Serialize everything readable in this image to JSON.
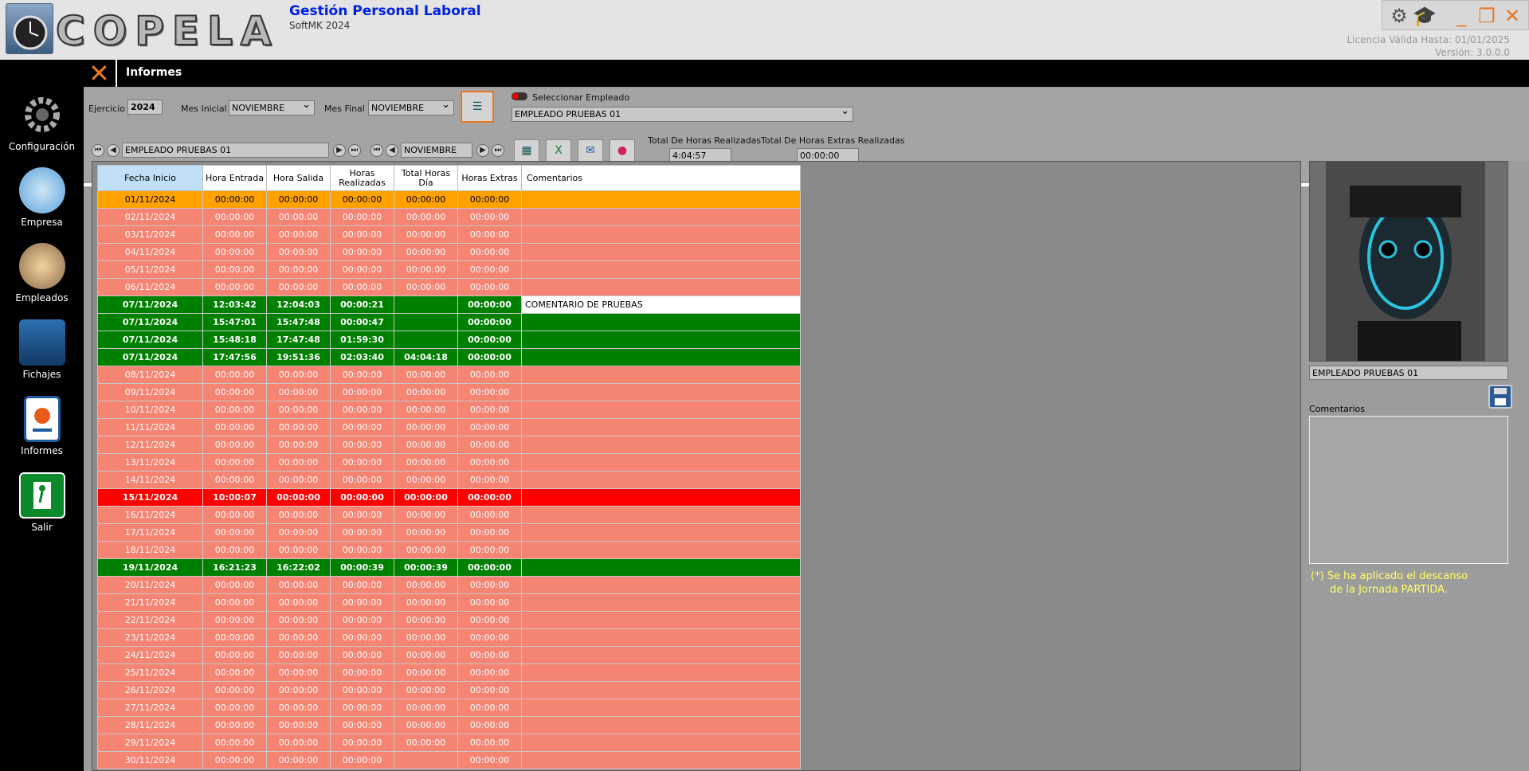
{
  "app": {
    "title": "Gestión Personal Laboral",
    "subtitle": "SoftMK 2024",
    "logo_text": "COPELA",
    "license": "Licencia Válida Hasta: 01/01/2025",
    "version": "Versión: 3.0.0.0"
  },
  "sidebar": {
    "items": [
      {
        "label": "Configuración",
        "icon": "gears-icon"
      },
      {
        "label": "Empresa",
        "icon": "building-icon"
      },
      {
        "label": "Empleados",
        "icon": "people-icon"
      },
      {
        "label": "Fichajes",
        "icon": "clock-icon"
      },
      {
        "label": "Informes",
        "icon": "report-icon"
      },
      {
        "label": "Salir",
        "icon": "exit-icon"
      }
    ]
  },
  "header": {
    "title": "Informes"
  },
  "filters": {
    "ejercicio_label": "Ejercicio",
    "ejercicio_value": "2024",
    "mes_inicial_label": "Mes Inicial",
    "mes_inicial_value": "NOVIEMBRE",
    "mes_final_label": "Mes Final",
    "mes_final_value": "NOVIEMBRE",
    "seleccionar_label": "Seleccionar Empleado",
    "empleado_value": "EMPLEADO PRUEBAS 01"
  },
  "nav": {
    "empleado": "EMPLEADO PRUEBAS 01",
    "mes": "NOVIEMBRE",
    "total_horas_label": "Total De Horas Realizadas",
    "total_horas_value": "4:04:57",
    "total_extras_label": "Total De Horas Extras Realizadas",
    "total_extras_value": "00:00:00"
  },
  "table": {
    "headers": [
      "Fecha Inicio",
      "Hora Entrada",
      "Hora Salida",
      "Horas Realizadas",
      "Total Horas Día",
      "Horas Extras",
      "Comentarios"
    ],
    "rows": [
      {
        "style": "orange",
        "cells": [
          "01/11/2024",
          "00:00:00",
          "00:00:00",
          "00:00:00",
          "00:00:00",
          "00:00:00",
          ""
        ]
      },
      {
        "style": "pink",
        "cells": [
          "02/11/2024",
          "00:00:00",
          "00:00:00",
          "00:00:00",
          "00:00:00",
          "00:00:00",
          ""
        ]
      },
      {
        "style": "pink",
        "cells": [
          "03/11/2024",
          "00:00:00",
          "00:00:00",
          "00:00:00",
          "00:00:00",
          "00:00:00",
          ""
        ]
      },
      {
        "style": "pink",
        "cells": [
          "04/11/2024",
          "00:00:00",
          "00:00:00",
          "00:00:00",
          "00:00:00",
          "00:00:00",
          ""
        ]
      },
      {
        "style": "pink",
        "cells": [
          "05/11/2024",
          "00:00:00",
          "00:00:00",
          "00:00:00",
          "00:00:00",
          "00:00:00",
          ""
        ]
      },
      {
        "style": "pink",
        "cells": [
          "06/11/2024",
          "00:00:00",
          "00:00:00",
          "00:00:00",
          "00:00:00",
          "00:00:00",
          ""
        ]
      },
      {
        "style": "green",
        "cells": [
          "07/11/2024",
          "12:03:42",
          "12:04:03",
          "00:00:21",
          "",
          "00:00:00",
          "COMENTARIO DE PRUEBAS"
        ]
      },
      {
        "style": "green",
        "cells": [
          "07/11/2024",
          "15:47:01",
          "15:47:48",
          "00:00:47",
          "",
          "00:00:00",
          ""
        ]
      },
      {
        "style": "green",
        "cells": [
          "07/11/2024",
          "15:48:18",
          "17:47:48",
          "01:59:30",
          "",
          "00:00:00",
          ""
        ]
      },
      {
        "style": "green",
        "cells": [
          "07/11/2024",
          "17:47:56",
          "19:51:36",
          "02:03:40",
          "04:04:18",
          "00:00:00",
          ""
        ]
      },
      {
        "style": "pink",
        "cells": [
          "08/11/2024",
          "00:00:00",
          "00:00:00",
          "00:00:00",
          "00:00:00",
          "00:00:00",
          ""
        ]
      },
      {
        "style": "pink",
        "cells": [
          "09/11/2024",
          "00:00:00",
          "00:00:00",
          "00:00:00",
          "00:00:00",
          "00:00:00",
          ""
        ]
      },
      {
        "style": "pink",
        "cells": [
          "10/11/2024",
          "00:00:00",
          "00:00:00",
          "00:00:00",
          "00:00:00",
          "00:00:00",
          ""
        ]
      },
      {
        "style": "pink",
        "cells": [
          "11/11/2024",
          "00:00:00",
          "00:00:00",
          "00:00:00",
          "00:00:00",
          "00:00:00",
          ""
        ]
      },
      {
        "style": "pink",
        "cells": [
          "12/11/2024",
          "00:00:00",
          "00:00:00",
          "00:00:00",
          "00:00:00",
          "00:00:00",
          ""
        ]
      },
      {
        "style": "pink",
        "cells": [
          "13/11/2024",
          "00:00:00",
          "00:00:00",
          "00:00:00",
          "00:00:00",
          "00:00:00",
          ""
        ]
      },
      {
        "style": "pink",
        "cells": [
          "14/11/2024",
          "00:00:00",
          "00:00:00",
          "00:00:00",
          "00:00:00",
          "00:00:00",
          ""
        ]
      },
      {
        "style": "red",
        "cells": [
          "15/11/2024",
          "10:00:07",
          "00:00:00",
          "00:00:00",
          "00:00:00",
          "00:00:00",
          ""
        ]
      },
      {
        "style": "pink",
        "cells": [
          "16/11/2024",
          "00:00:00",
          "00:00:00",
          "00:00:00",
          "00:00:00",
          "00:00:00",
          ""
        ]
      },
      {
        "style": "pink",
        "cells": [
          "17/11/2024",
          "00:00:00",
          "00:00:00",
          "00:00:00",
          "00:00:00",
          "00:00:00",
          ""
        ]
      },
      {
        "style": "pink",
        "cells": [
          "18/11/2024",
          "00:00:00",
          "00:00:00",
          "00:00:00",
          "00:00:00",
          "00:00:00",
          ""
        ]
      },
      {
        "style": "green",
        "cells": [
          "19/11/2024",
          "16:21:23",
          "16:22:02",
          "00:00:39",
          "00:00:39",
          "00:00:00",
          ""
        ]
      },
      {
        "style": "pink",
        "cells": [
          "20/11/2024",
          "00:00:00",
          "00:00:00",
          "00:00:00",
          "00:00:00",
          "00:00:00",
          ""
        ]
      },
      {
        "style": "pink",
        "cells": [
          "21/11/2024",
          "00:00:00",
          "00:00:00",
          "00:00:00",
          "00:00:00",
          "00:00:00",
          ""
        ]
      },
      {
        "style": "pink",
        "cells": [
          "22/11/2024",
          "00:00:00",
          "00:00:00",
          "00:00:00",
          "00:00:00",
          "00:00:00",
          ""
        ]
      },
      {
        "style": "pink",
        "cells": [
          "23/11/2024",
          "00:00:00",
          "00:00:00",
          "00:00:00",
          "00:00:00",
          "00:00:00",
          ""
        ]
      },
      {
        "style": "pink",
        "cells": [
          "24/11/2024",
          "00:00:00",
          "00:00:00",
          "00:00:00",
          "00:00:00",
          "00:00:00",
          ""
        ]
      },
      {
        "style": "pink",
        "cells": [
          "25/11/2024",
          "00:00:00",
          "00:00:00",
          "00:00:00",
          "00:00:00",
          "00:00:00",
          ""
        ]
      },
      {
        "style": "pink",
        "cells": [
          "26/11/2024",
          "00:00:00",
          "00:00:00",
          "00:00:00",
          "00:00:00",
          "00:00:00",
          ""
        ]
      },
      {
        "style": "pink",
        "cells": [
          "27/11/2024",
          "00:00:00",
          "00:00:00",
          "00:00:00",
          "00:00:00",
          "00:00:00",
          ""
        ]
      },
      {
        "style": "pink",
        "cells": [
          "28/11/2024",
          "00:00:00",
          "00:00:00",
          "00:00:00",
          "00:00:00",
          "00:00:00",
          ""
        ]
      },
      {
        "style": "pink",
        "cells": [
          "29/11/2024",
          "00:00:00",
          "00:00:00",
          "00:00:00",
          "00:00:00",
          "00:00:00",
          ""
        ]
      },
      {
        "style": "pink",
        "cells": [
          "30/11/2024",
          "00:00:00",
          "00:00:00",
          "00:00:00",
          "",
          "00:00:00",
          ""
        ]
      }
    ]
  },
  "right": {
    "employee_name": "EMPLEADO PRUEBAS 01",
    "comentarios_label": "Comentarios",
    "note_line1": "(*) Se ha aplicado el descanso",
    "note_line2": "de la Jornada PARTIDA."
  },
  "colors": {
    "orange_row": "#ffa200",
    "pink_row": "#f58472",
    "green_row": "#008000",
    "red_row": "#ff0000",
    "title_blue": "#0020e0",
    "note_yellow": "#ffff66"
  }
}
